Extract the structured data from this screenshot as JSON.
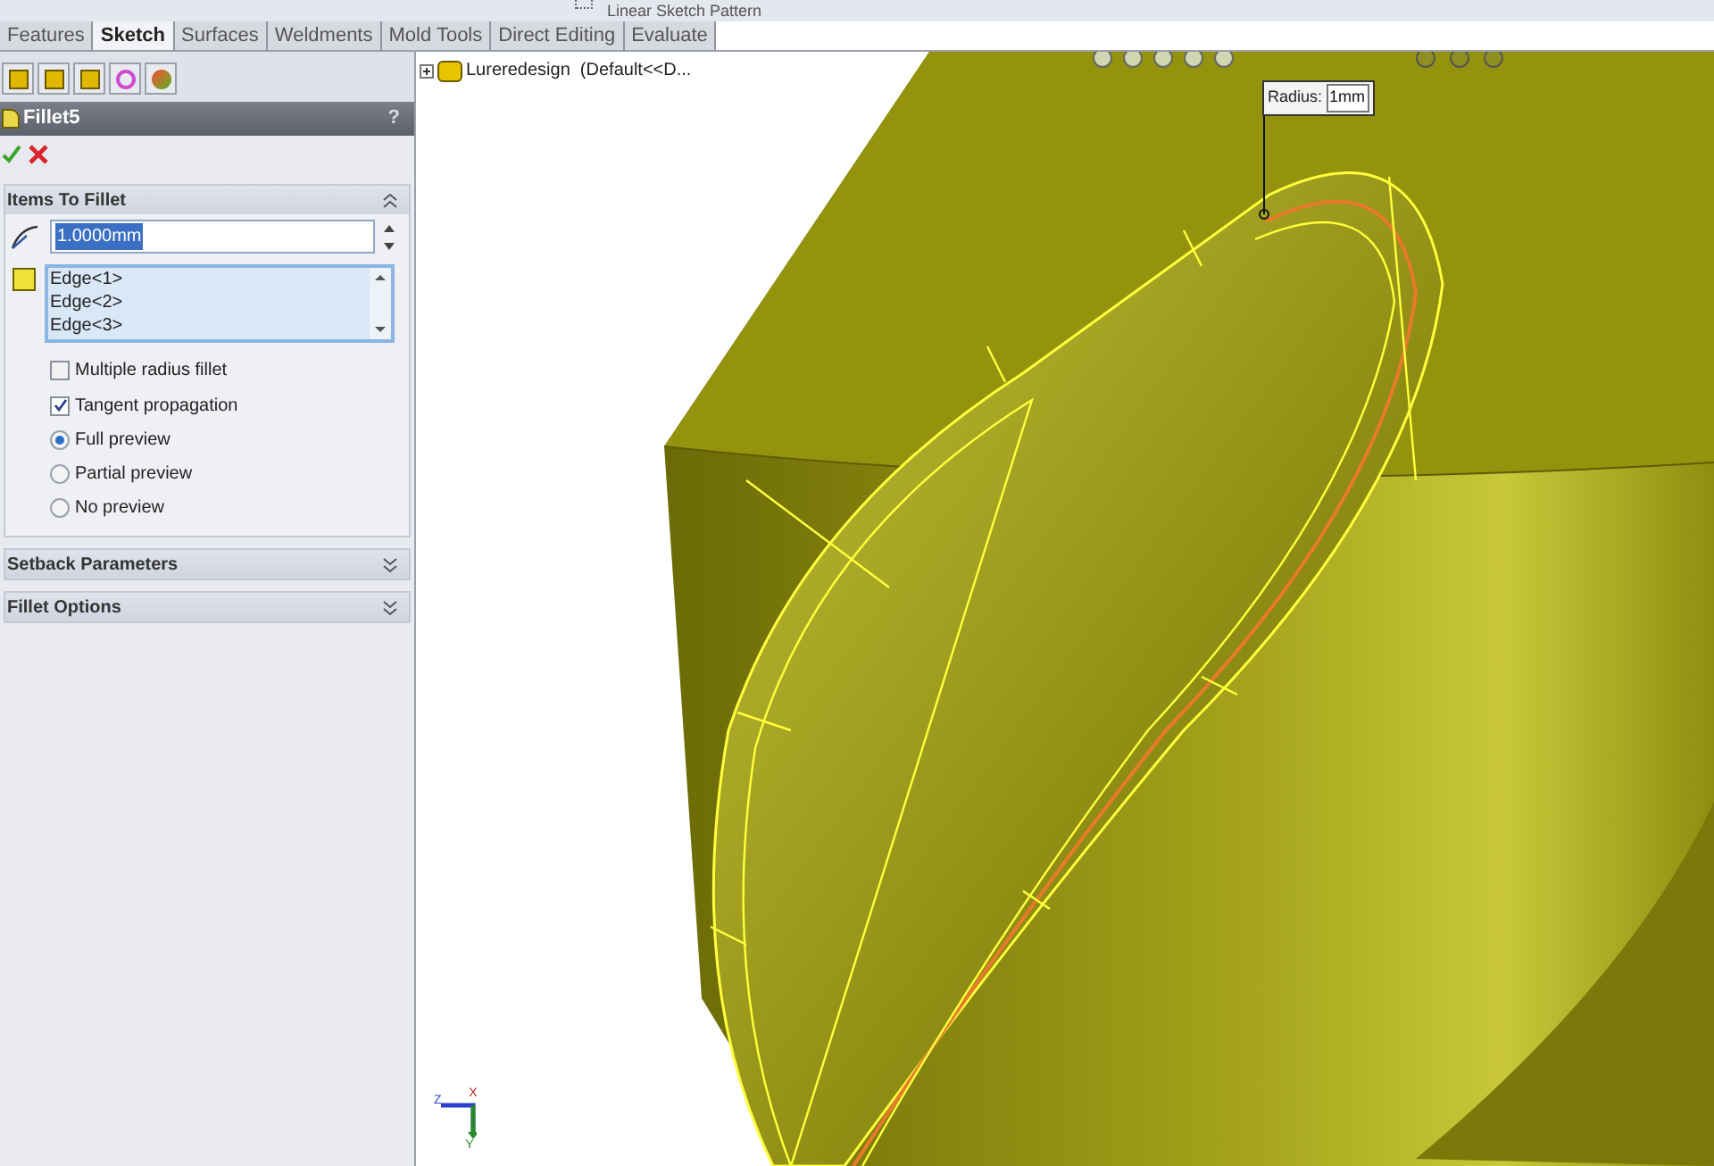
{
  "toolbar": {
    "pattern_label": "Linear Sketch Pattern"
  },
  "tabs": [
    {
      "label": "Features",
      "selected": false
    },
    {
      "label": "Sketch",
      "selected": true
    },
    {
      "label": "Surfaces",
      "selected": false
    },
    {
      "label": "Weldments",
      "selected": false
    },
    {
      "label": "Mold Tools",
      "selected": false
    },
    {
      "label": "Direct Editing",
      "selected": false
    },
    {
      "label": "Evaluate",
      "selected": false
    }
  ],
  "feature": {
    "title": "Fillet5",
    "help": "?"
  },
  "sections": [
    {
      "title": "Items To Fillet",
      "expanded": true
    },
    {
      "title": "Setback Parameters",
      "expanded": false
    },
    {
      "title": "Fillet Options",
      "expanded": false
    }
  ],
  "radius_field": {
    "value": "1.0000mm"
  },
  "edges": [
    "Edge<1>",
    "Edge<2>",
    "Edge<3>"
  ],
  "options": [
    {
      "kind": "checkbox",
      "label": "Multiple radius fillet",
      "checked": false
    },
    {
      "kind": "checkbox",
      "label": "Tangent propagation",
      "checked": true
    },
    {
      "kind": "radio",
      "label": "Full preview",
      "selected": true
    },
    {
      "kind": "radio",
      "label": "Partial preview",
      "selected": false
    },
    {
      "kind": "radio",
      "label": "No preview",
      "selected": false
    }
  ],
  "tree": {
    "root": "Lureredesign  (Default<<D...",
    "expanded": false
  },
  "callout": {
    "label": "Radius:",
    "value": "1mm"
  },
  "triad": {
    "x": "X",
    "y": "Y",
    "z": "Z"
  }
}
